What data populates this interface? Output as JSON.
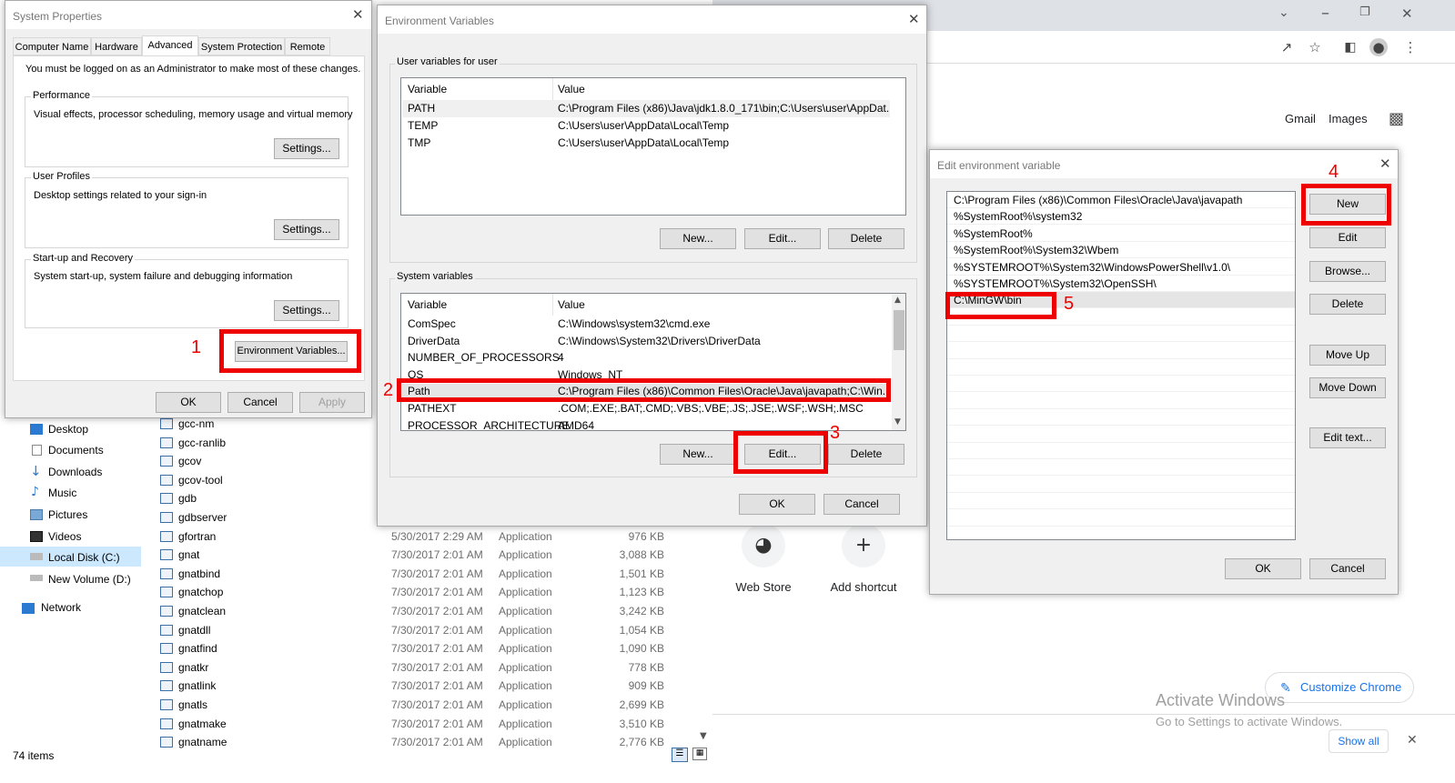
{
  "chrome": {
    "links": [
      "Gmail",
      "Images"
    ],
    "shortcuts": [
      "Web Store",
      "Add shortcut"
    ],
    "customize_label": "Customize Chrome",
    "activate_title": "Activate Windows",
    "activate_sub": "Go to Settings to activate Windows.",
    "show_all": "Show all"
  },
  "explorer": {
    "nav": [
      "Desktop",
      "Documents",
      "Downloads",
      "Music",
      "Pictures",
      "Videos",
      "Local Disk (C:)",
      "New Volume (D:)",
      "Network"
    ],
    "status": "74 items",
    "files_top": [
      "gcc-nm",
      "gcc-ranlib",
      "gcov",
      "gcov-tool",
      "gdb",
      "gdbserver"
    ],
    "files": [
      {
        "name": "gfortran",
        "date": "5/30/2017 2:29 AM",
        "type": "Application",
        "size": "976 KB"
      },
      {
        "name": "gnat",
        "date": "7/30/2017 2:01 AM",
        "type": "Application",
        "size": "3,088 KB"
      },
      {
        "name": "gnatbind",
        "date": "7/30/2017 2:01 AM",
        "type": "Application",
        "size": "1,501 KB"
      },
      {
        "name": "gnatchop",
        "date": "7/30/2017 2:01 AM",
        "type": "Application",
        "size": "1,123 KB"
      },
      {
        "name": "gnatclean",
        "date": "7/30/2017 2:01 AM",
        "type": "Application",
        "size": "3,242 KB"
      },
      {
        "name": "gnatdll",
        "date": "7/30/2017 2:01 AM",
        "type": "Application",
        "size": "1,054 KB"
      },
      {
        "name": "gnatfind",
        "date": "7/30/2017 2:01 AM",
        "type": "Application",
        "size": "1,090 KB"
      },
      {
        "name": "gnatkr",
        "date": "7/30/2017 2:01 AM",
        "type": "Application",
        "size": "778 KB"
      },
      {
        "name": "gnatlink",
        "date": "7/30/2017 2:01 AM",
        "type": "Application",
        "size": "909 KB"
      },
      {
        "name": "gnatls",
        "date": "7/30/2017 2:01 AM",
        "type": "Application",
        "size": "2,699 KB"
      },
      {
        "name": "gnatmake",
        "date": "7/30/2017 2:01 AM",
        "type": "Application",
        "size": "3,510 KB"
      },
      {
        "name": "gnatname",
        "date": "7/30/2017 2:01 AM",
        "type": "Application",
        "size": "2,776 KB"
      }
    ]
  },
  "sysprops": {
    "title": "System Properties",
    "tabs": [
      "Computer Name",
      "Hardware",
      "Advanced",
      "System Protection",
      "Remote"
    ],
    "admin_note": "You must be logged on as an Administrator to make most of these changes.",
    "perf_label": "Performance",
    "perf_desc": "Visual effects, processor scheduling, memory usage and virtual memory",
    "profiles_label": "User Profiles",
    "profiles_desc": "Desktop settings related to your sign-in",
    "startup_label": "Start-up and Recovery",
    "startup_desc": "System start-up, system failure and debugging information",
    "settings": "Settings...",
    "env_vars": "Environment Variables...",
    "ok": "OK",
    "cancel": "Cancel",
    "apply": "Apply"
  },
  "envvars": {
    "title": "Environment Variables",
    "user_label": "User variables for user",
    "col_var": "Variable",
    "col_val": "Value",
    "user_rows": [
      {
        "var": "PATH",
        "val": "C:\\Program Files (x86)\\Java\\jdk1.8.0_171\\bin;C:\\Users\\user\\AppDat..."
      },
      {
        "var": "TEMP",
        "val": "C:\\Users\\user\\AppData\\Local\\Temp"
      },
      {
        "var": "TMP",
        "val": "C:\\Users\\user\\AppData\\Local\\Temp"
      }
    ],
    "sys_label": "System variables",
    "sys_rows": [
      {
        "var": "ComSpec",
        "val": "C:\\Windows\\system32\\cmd.exe"
      },
      {
        "var": "DriverData",
        "val": "C:\\Windows\\System32\\Drivers\\DriverData"
      },
      {
        "var": "NUMBER_OF_PROCESSORS",
        "val": "4"
      },
      {
        "var": "OS",
        "val": "Windows_NT"
      },
      {
        "var": "Path",
        "val": "C:\\Program Files (x86)\\Common Files\\Oracle\\Java\\javapath;C:\\Win..."
      },
      {
        "var": "PATHEXT",
        "val": ".COM;.EXE;.BAT;.CMD;.VBS;.VBE;.JS;.JSE;.WSF;.WSH;.MSC"
      },
      {
        "var": "PROCESSOR_ARCHITECTURE",
        "val": "AMD64"
      }
    ],
    "new": "New...",
    "edit": "Edit...",
    "delete": "Delete",
    "ok": "OK",
    "cancel": "Cancel"
  },
  "editenv": {
    "title": "Edit environment variable",
    "entries": [
      "C:\\Program Files (x86)\\Common Files\\Oracle\\Java\\javapath",
      "%SystemRoot%\\system32",
      "%SystemRoot%",
      "%SystemRoot%\\System32\\Wbem",
      "%SYSTEMROOT%\\System32\\WindowsPowerShell\\v1.0\\",
      "%SYSTEMROOT%\\System32\\OpenSSH\\",
      "C:\\MinGW\\bin"
    ],
    "new": "New",
    "edit": "Edit",
    "browse": "Browse...",
    "delete": "Delete",
    "move_up": "Move Up",
    "move_down": "Move Down",
    "edit_text": "Edit text...",
    "ok": "OK",
    "cancel": "Cancel"
  },
  "annotations": [
    "1",
    "2",
    "3",
    "4",
    "5"
  ],
  "colors": {
    "annotation_red": "#ee0000",
    "chrome_blue": "#1a73e8",
    "selection": "#e5e5e5"
  }
}
